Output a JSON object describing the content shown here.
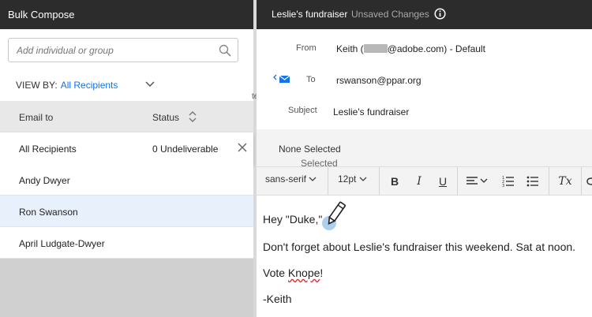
{
  "left_panel": {
    "title": "Bulk Compose",
    "search_placeholder": "Add individual or group",
    "view_by_label": "VIEW BY:",
    "view_by_value": "All Recipients",
    "columns": {
      "email_to": "Email to",
      "status": "Status"
    },
    "all_row": {
      "name": "All Recipients",
      "status": "0 Undeliverable"
    },
    "recipients": [
      "Andy Dwyer",
      "Ron Swanson",
      "April Ludgate-Dwyer"
    ],
    "selected_recipient": "Ron Swanson"
  },
  "compose": {
    "title": "Leslie's fundraiser",
    "unsaved": "Unsaved Changes",
    "from_label": "From",
    "from_prefix": "Keith (",
    "from_suffix": "@adobe.com) - Default",
    "to_label": "To",
    "to_value": "rswanson@ppar.org",
    "subject_label": "Subject",
    "subject_value": "Leslie's fundraiser",
    "template_label": "Selected Template:",
    "template_value": "None Selected"
  },
  "toolbar": {
    "font": "sans-serif",
    "size": "12pt",
    "bold": "B",
    "italic": "I",
    "underline": "U",
    "clear": "Tx"
  },
  "body": {
    "line1": "Hey \"Duke,\"",
    "line2": "Don't forget about Leslie's fundraiser this weekend. Sat at noon.",
    "line3_a": "Vote ",
    "line3_b": "Knope",
    "line3_c": "!",
    "line4": "-Keith"
  },
  "peek_text": "te",
  "colors": {
    "accent": "#1473e6",
    "header_bg": "#2c2c2c",
    "selected_row": "#e8f1fb"
  },
  "icons": [
    "search-icon",
    "chevron-down-icon",
    "sort-icon",
    "close-icon",
    "info-icon",
    "email-icon",
    "pencil-cursor-icon"
  ]
}
